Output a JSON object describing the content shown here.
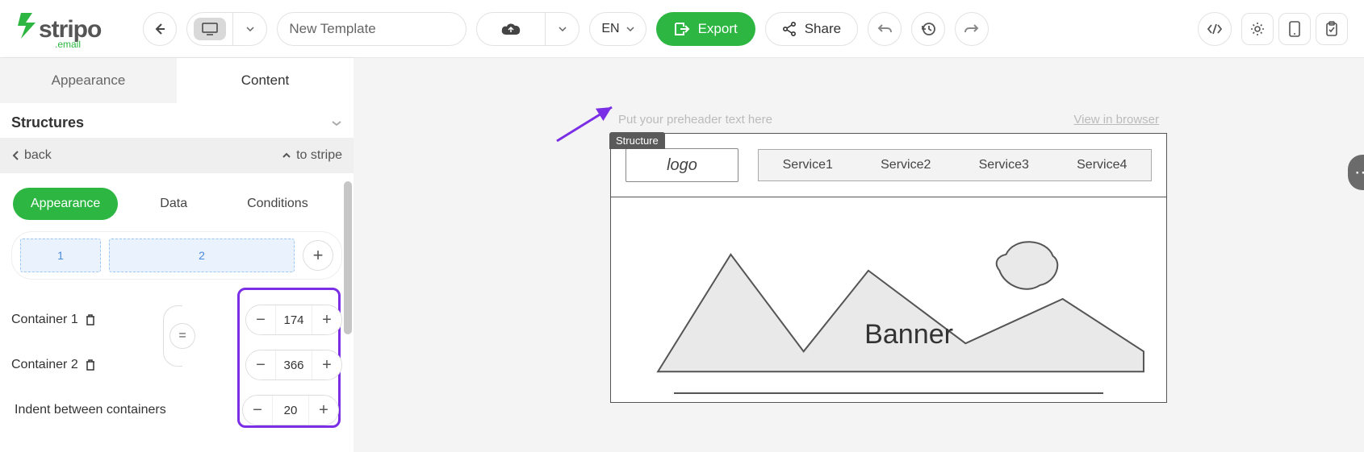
{
  "brand": {
    "name": "stripo",
    "sub": ".email"
  },
  "topbar": {
    "title": "New Template",
    "lang": "EN",
    "export_label": "Export",
    "share_label": "Share"
  },
  "sidebar": {
    "tabs": {
      "appearance": "Appearance",
      "content": "Content"
    },
    "section_title": "Structures",
    "back_label": "back",
    "to_stripe_label": "to stripe",
    "sub_tabs": {
      "appearance": "Appearance",
      "data": "Data",
      "conditions": "Conditions"
    },
    "columns": {
      "a": "1",
      "b": "2"
    },
    "containers": [
      {
        "label": "Container 1",
        "width": "174"
      },
      {
        "label": "Container 2",
        "width": "366"
      }
    ],
    "equal": "=",
    "indent_label": "Indent between containers",
    "indent_value": "20"
  },
  "email": {
    "preheader_placeholder": "Put your preheader text here",
    "view_in_browser": "View in browser",
    "structure_tag": "Structure",
    "logo_text": "logo",
    "nav": [
      "Service1",
      "Service2",
      "Service3",
      "Service4"
    ],
    "banner_text": "Banner"
  }
}
